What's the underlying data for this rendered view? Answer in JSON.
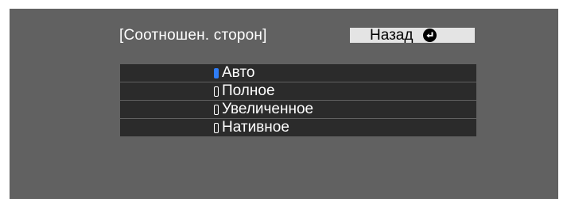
{
  "header": {
    "title": "[Соотношен. сторон]",
    "back_label": "Назад",
    "back_icon": "return-icon"
  },
  "menu": {
    "items": [
      {
        "label": "Авто",
        "selected": true
      },
      {
        "label": "Полное",
        "selected": false
      },
      {
        "label": "Увеличенное",
        "selected": false
      },
      {
        "label": "Нативное",
        "selected": false
      }
    ]
  },
  "colors": {
    "panel_background": "#616161",
    "item_background": "#2b2b2b",
    "selected_indicator": "#2f7df6",
    "button_background": "#e4e4e4"
  }
}
